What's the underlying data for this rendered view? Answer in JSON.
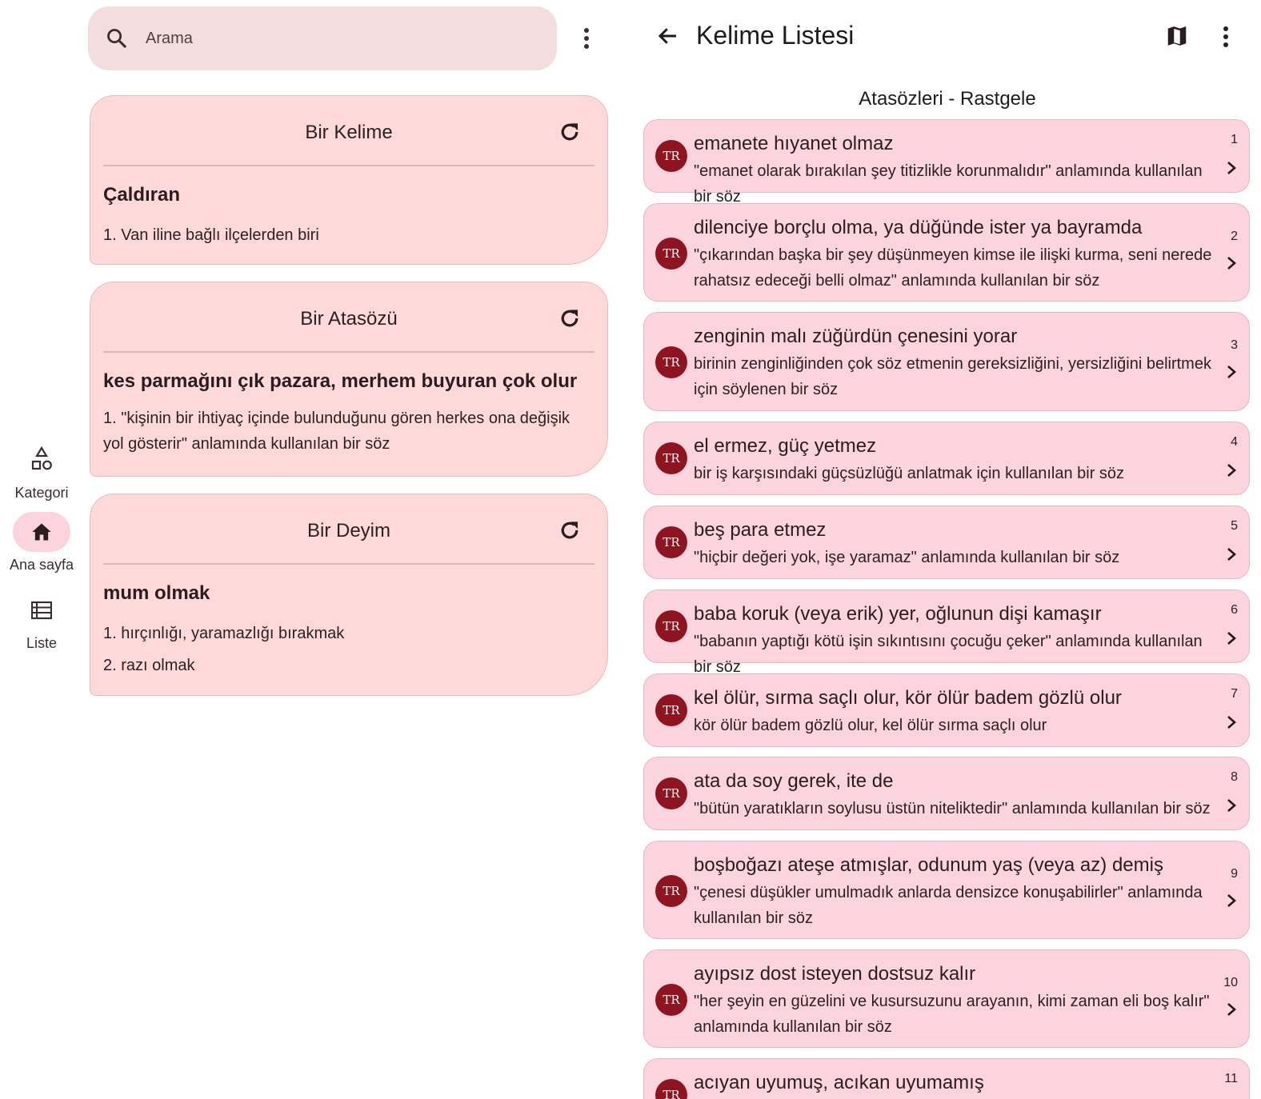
{
  "nav": {
    "items": [
      {
        "label": "Kategori",
        "icon": "category-icon"
      },
      {
        "label": "Ana sayfa",
        "icon": "home-icon"
      },
      {
        "label": "Liste",
        "icon": "list-icon"
      }
    ]
  },
  "search": {
    "placeholder": "Arama"
  },
  "cards": [
    {
      "title": "Bir Kelime",
      "word": "Çaldıran",
      "definitions": [
        "1. Van iline bağlı ilçelerden biri"
      ]
    },
    {
      "title": "Bir Atasözü",
      "word": "kes parmağını çık pazara, merhem buyuran çok olur",
      "definitions": [
        "1. \"kişinin bir ihtiyaç içinde bulunduğunu gören herkes ona değişik yol gösterir\" anlamında kullanılan bir söz"
      ]
    },
    {
      "title": "Bir Deyim",
      "word": "mum olmak",
      "definitions": [
        "1. hırçınlığı, yaramazlığı bırakmak",
        "2. razı olmak"
      ]
    }
  ],
  "list": {
    "title": "Kelime Listesi",
    "subtitle": "Atasözleri - Rastgele",
    "badge": "TR",
    "items": [
      {
        "title": "emanete hıyanet olmaz",
        "desc": "\"emanet olarak bırakılan şey titizlikle korunmalıdır\" anlamında kullanılan bir söz",
        "num": "1"
      },
      {
        "title": "dilenciye borçlu olma, ya düğünde ister ya bayramda",
        "desc": "\"çıkarından başka bir şey düşünmeyen kimse ile ilişki kurma, seni nerede rahatsız edeceği belli olmaz\" anlamında kullanılan bir söz",
        "num": "2"
      },
      {
        "title": "zenginin malı züğürdün çenesini yorar",
        "desc": "birinin zenginliğinden çok söz etmenin gereksizliğini, yersizliğini belirtmek için söylenen bir söz",
        "num": "3"
      },
      {
        "title": "el ermez, güç yetmez",
        "desc": "bir iş karşısındaki güçsüzlüğü anlatmak için kullanılan bir söz",
        "num": "4"
      },
      {
        "title": "beş para etmez",
        "desc": "\"hiçbir değeri yok, işe yaramaz\" anlamında kullanılan bir söz",
        "num": "5"
      },
      {
        "title": "baba koruk (veya erik) yer, oğlunun dişi kamaşır",
        "desc": "\"babanın yaptığı kötü işin sıkıntısını çocuğu çeker\" anlamında kullanılan bir söz",
        "num": "6"
      },
      {
        "title": "kel ölür, sırma saçlı olur, kör ölür badem gözlü olur",
        "desc": "kör ölür badem gözlü olur, kel ölür sırma saçlı olur",
        "num": "7"
      },
      {
        "title": "ata da soy gerek, ite de",
        "desc": "\"bütün yaratıkların soylusu üstün niteliktedir\" anlamında kullanılan bir söz",
        "num": "8"
      },
      {
        "title": "boşboğazı ateşe atmışlar, odunum yaş (veya az) demiş",
        "desc": "\"çenesi düşükler umulmadık anlarda densizce konuşabilirler\" anlamında kullanılan bir söz",
        "num": "9"
      },
      {
        "title": "ayıpsız dost isteyen dostsuz kalır",
        "desc": "\"her şeyin en güzelini ve kusursuzunu arayanın, kimi zaman eli boş kalır\" anlamında kullanılan bir söz",
        "num": "10"
      },
      {
        "title": "acıyan uyumuş, acıkan uyumamış",
        "desc": "",
        "num": "11"
      }
    ]
  },
  "colors": {
    "accent": "#8e1420",
    "card": "#fdd9d9",
    "list_item": "#fcd4de",
    "search_bg": "#f3dddd"
  }
}
